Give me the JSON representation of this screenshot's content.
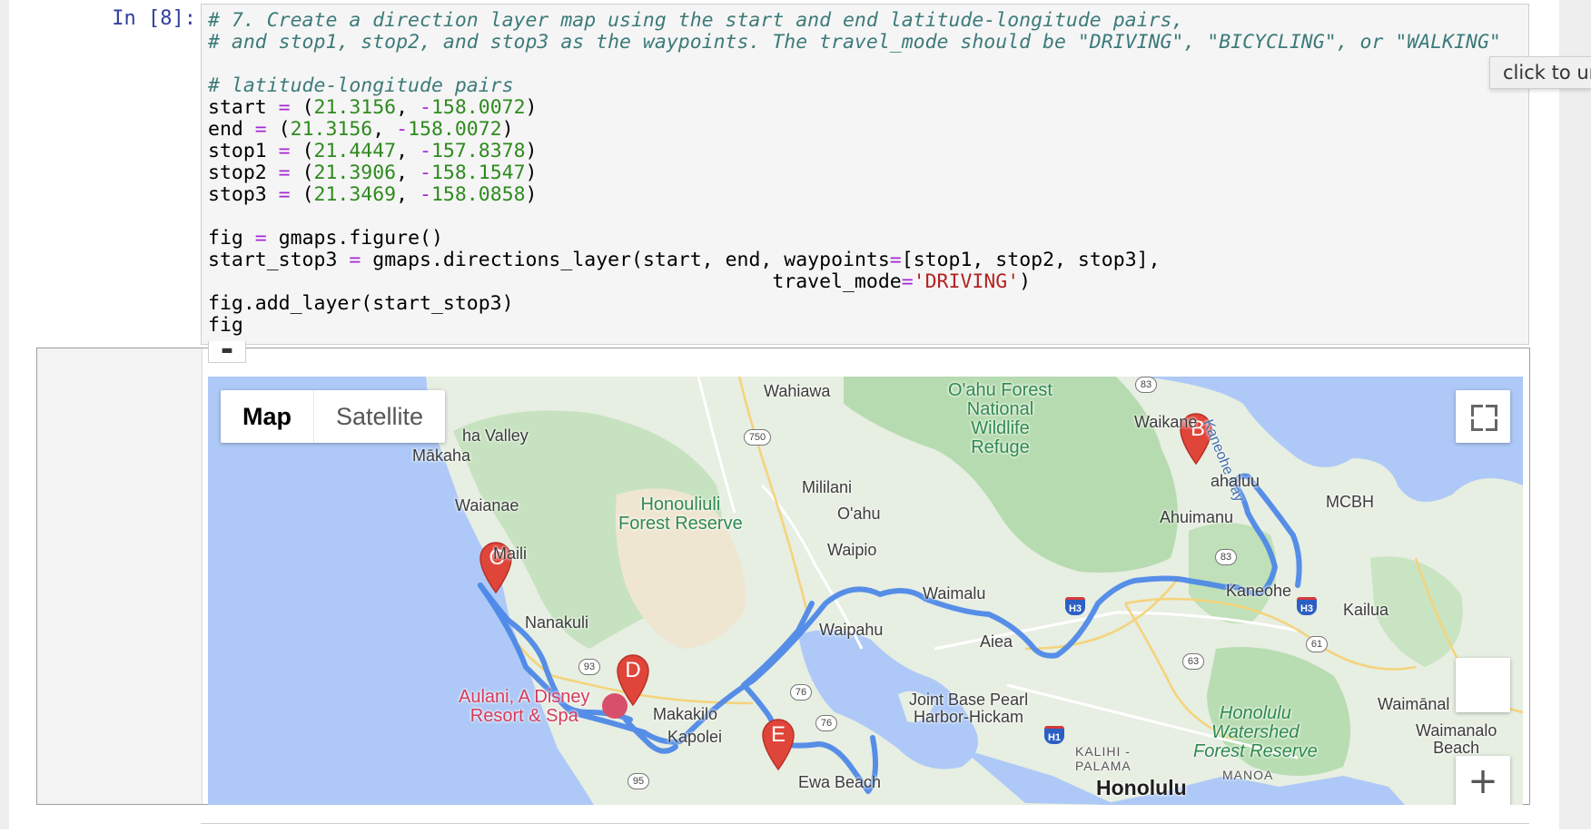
{
  "notebook": {
    "prompt": "In [8]:",
    "tooltip": "click to un",
    "collapse_icon": "download-icon"
  },
  "code_lines": {
    "l1": "# 7. Create a direction layer map using the start and end latitude-longitude pairs,",
    "l2": "# and stop1, stop2, and stop3 as the waypoints. The travel_mode should be \"DRIVING\", \"BICYCLING\", or \"WALKING\"",
    "l3": "# latitude-longitude pairs",
    "start_lat": "21.3156",
    "start_lng": "158.0072",
    "end_lat": "21.3156",
    "end_lng": "158.0072",
    "stop1_lat": "21.4447",
    "stop1_lng": "157.8378",
    "stop2_lat": "21.3906",
    "stop2_lng": "158.1547",
    "stop3_lat": "21.3469",
    "stop3_lng": "158.0858",
    "fig_line": "gmaps.figure()",
    "layer_line": "gmaps.directions_layer(start, end, waypoints",
    "waypoints_list": "[stop1, stop2, stop3],",
    "travel_mode_kw": "travel_mode",
    "travel_mode_val": "'DRIVING'",
    "add_layer": "fig.add_layer(start_stop3)",
    "fig": "fig"
  },
  "map": {
    "map_type": {
      "map": "Map",
      "satellite": "Satellite"
    },
    "zoom_in": "+",
    "markers": {
      "b": "B",
      "c": "C",
      "d": "D",
      "e": "E"
    },
    "places": {
      "wahiawa": "Wahiawa",
      "oahu_forest": "O'ahu Forest\nNational\nWildlife\nRefuge",
      "waikane": "Waikane",
      "kaneohe_bay": "Kaneohe Bay",
      "valley": "ha Valley",
      "makaha": "Mākaha",
      "waianae": "Waianae",
      "honouliuli": "Honouliuli\nForest Reserve",
      "mililani": "Mililani",
      "oahu": "O'ahu",
      "waipio": "Waipio",
      "kahaluu": "ahaluu",
      "ahuimanu": "Ahuimanu",
      "mcbh": "MCBH",
      "maili": "Maili",
      "nanakuli": "Nanakuli",
      "waimalu": "Waimalu",
      "kaneohe": "Kaneohe",
      "kailua": "Kailua",
      "waipahu": "Waipahu",
      "aiea": "Aiea",
      "aulani": "Aulani, A Disney\nResort & Spa",
      "makakilo": "Makakilo",
      "kapolei": "Kapolei",
      "jbphh": "Joint Base Pearl\nHarbor-Hickam",
      "honolulu_watershed": "Honolulu\nWatershed\nForest Reserve",
      "waimanalo": "Waimānal",
      "waimanalo_beach": "Waimanalo\nBeach",
      "kalihi": "KALIHI -\nPALAMA",
      "manoa": "MANOA",
      "ewa_beach": "Ewa Beach",
      "honolulu": "Honolulu"
    },
    "routes": {
      "r83a": "83",
      "r750": "750",
      "r83b": "83",
      "h3": "H3",
      "h3b": "H3",
      "r61": "61",
      "r63": "63",
      "r93": "93",
      "r76": "76",
      "r76b": "76",
      "r95": "95",
      "h1": "H1"
    },
    "colors": {
      "route": "#4a86e8",
      "marker": "#e0453a",
      "water": "#aec9f7"
    }
  }
}
